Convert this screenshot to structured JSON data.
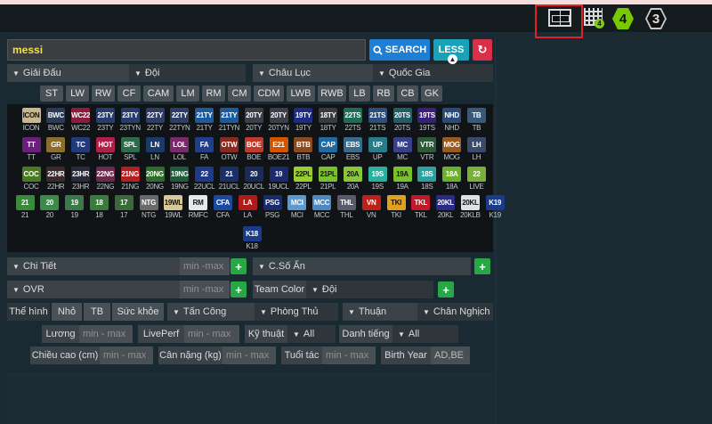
{
  "search": {
    "value": "messi",
    "search_label": "SEARCH",
    "less_label": "LESS",
    "reset_icon": "refresh-icon"
  },
  "filters": {
    "league": "Giải Đấu",
    "team": "Đội",
    "continent": "Châu Lục",
    "nation": "Quốc Gia"
  },
  "positions": [
    "ST",
    "LW",
    "RW",
    "CF",
    "CAM",
    "LM",
    "RM",
    "CM",
    "CDM",
    "LWB",
    "RWB",
    "LB",
    "RB",
    "CB",
    "GK"
  ],
  "seasons": [
    {
      "code": "ICON",
      "badge": "ICON",
      "color": "#c8b889"
    },
    {
      "code": "BWC",
      "badge": "BWC",
      "color": "#2b3a55"
    },
    {
      "code": "WC22",
      "badge": "WC22",
      "color": "#8a1d3d"
    },
    {
      "code": "23TY",
      "badge": "23TY",
      "color": "#273c6e"
    },
    {
      "code": "23TYN",
      "badge": "23TY",
      "color": "#273c6e"
    },
    {
      "code": "22TY",
      "badge": "22TY",
      "color": "#2d3d66"
    },
    {
      "code": "22TYN",
      "badge": "22TY",
      "color": "#2d3d66"
    },
    {
      "code": "21TY",
      "badge": "21TY",
      "color": "#1b5a9c"
    },
    {
      "code": "21TYN",
      "badge": "21TY",
      "color": "#1b5a9c"
    },
    {
      "code": "20TY",
      "badge": "20TY",
      "color": "#3a3f4a"
    },
    {
      "code": "20TYN",
      "badge": "20TY",
      "color": "#3a3f4a"
    },
    {
      "code": "19TY",
      "badge": "19TY",
      "color": "#1c2b86"
    },
    {
      "code": "18TY",
      "badge": "18TY",
      "color": "#3a3a3a"
    },
    {
      "code": "22TS",
      "badge": "22TS",
      "color": "#1e6b56"
    },
    {
      "code": "21TS",
      "badge": "21TS",
      "color": "#2b4f7a"
    },
    {
      "code": "20TS",
      "badge": "20TS",
      "color": "#245c66"
    },
    {
      "code": "19TS",
      "badge": "19TS",
      "color": "#3a1f7a"
    },
    {
      "code": "NHD",
      "badge": "NHD",
      "color": "#2a4a7a"
    },
    {
      "code": "TB",
      "badge": "TB",
      "color": "#385a7a"
    },
    {
      "code": "TT",
      "badge": "TT",
      "color": "#6a1f7a"
    },
    {
      "code": "GR",
      "badge": "GR",
      "color": "#8a6d2f"
    },
    {
      "code": "TC",
      "badge": "TC",
      "color": "#223a7a"
    },
    {
      "code": "HOT",
      "badge": "HOT",
      "color": "#b0204a"
    },
    {
      "code": "SPL",
      "badge": "SPL",
      "color": "#2f6a4a"
    },
    {
      "code": "LN",
      "badge": "LN",
      "color": "#1a3a6a"
    },
    {
      "code": "LOL",
      "badge": "LOL",
      "color": "#7a2a6a"
    },
    {
      "code": "FA",
      "badge": "FA",
      "color": "#1f3f8a"
    },
    {
      "code": "OTW",
      "badge": "OTW",
      "color": "#8a2a1f"
    },
    {
      "code": "BOE",
      "badge": "BOE",
      "color": "#c0392b"
    },
    {
      "code": "BOE21",
      "badge": "E21",
      "color": "#d35400"
    },
    {
      "code": "BTB",
      "badge": "BTB",
      "color": "#8a4a1f"
    },
    {
      "code": "CAP",
      "badge": "CAP",
      "color": "#1f6aa0"
    },
    {
      "code": "EBS",
      "badge": "EBS",
      "color": "#3a6a8a"
    },
    {
      "code": "UP",
      "badge": "UP",
      "color": "#2a7a8a"
    },
    {
      "code": "MC",
      "badge": "MC",
      "color": "#3a3f8a"
    },
    {
      "code": "VTR",
      "badge": "VTR",
      "color": "#2f5a3a"
    },
    {
      "code": "MOG",
      "badge": "MOG",
      "color": "#9a5a1f"
    },
    {
      "code": "LH",
      "badge": "LH",
      "color": "#3a4a6a"
    },
    {
      "code": "COC",
      "badge": "COC",
      "color": "#4a7a1f"
    },
    {
      "code": "22HR",
      "badge": "22HR",
      "color": "#3a2a2a"
    },
    {
      "code": "23HR",
      "badge": "23HR",
      "color": "#2a2a3a"
    },
    {
      "code": "22NG",
      "badge": "22NG",
      "color": "#6a2a4a"
    },
    {
      "code": "21NG",
      "badge": "21NG",
      "color": "#b02020"
    },
    {
      "code": "20NG",
      "badge": "20NG",
      "color": "#2f6a2f"
    },
    {
      "code": "19NG",
      "badge": "19NG",
      "color": "#1f5a3a"
    },
    {
      "code": "22UCL",
      "badge": "22",
      "color": "#1f3a8a"
    },
    {
      "code": "21UCL",
      "badge": "21",
      "color": "#1a2f6a"
    },
    {
      "code": "20UCL",
      "badge": "20",
      "color": "#1a2a5a"
    },
    {
      "code": "19UCL",
      "badge": "19",
      "color": "#1a2a6a"
    },
    {
      "code": "22PL",
      "badge": "22PL",
      "color": "#9acd32"
    },
    {
      "code": "21PL",
      "badge": "21PL",
      "color": "#7ac02a"
    },
    {
      "code": "20A",
      "badge": "20A",
      "color": "#8ac63a"
    },
    {
      "code": "19S",
      "badge": "19S",
      "color": "#2ab0a0"
    },
    {
      "code": "19A",
      "badge": "19A",
      "color": "#7ac02a"
    },
    {
      "code": "18S",
      "badge": "18S",
      "color": "#2aa0a0"
    },
    {
      "code": "18A",
      "badge": "18A",
      "color": "#6ab02a"
    },
    {
      "code": "LIVE",
      "badge": "22",
      "color": "#7ab03a"
    },
    {
      "code": "21",
      "badge": "21",
      "color": "#3a8a3a"
    },
    {
      "code": "20",
      "badge": "20",
      "color": "#3a8a4a"
    },
    {
      "code": "19",
      "badge": "19",
      "color": "#3a7a4a"
    },
    {
      "code": "18",
      "badge": "18",
      "color": "#3a7a3a"
    },
    {
      "code": "17",
      "badge": "17",
      "color": "#3a6a3a"
    },
    {
      "code": "NTG",
      "badge": "NTG",
      "color": "#6a6a6a"
    },
    {
      "code": "19WL",
      "badge": "19WL",
      "color": "#d8c89a"
    },
    {
      "code": "RMFC",
      "badge": "RM",
      "color": "#e8e8e8"
    },
    {
      "code": "CFA",
      "badge": "CFA",
      "color": "#1a4aa0"
    },
    {
      "code": "LA",
      "badge": "LA",
      "color": "#b01a1a"
    },
    {
      "code": "PSG",
      "badge": "PSG",
      "color": "#1a2a6a"
    },
    {
      "code": "MCI",
      "badge": "MCI",
      "color": "#5a9ad0"
    },
    {
      "code": "MCC",
      "badge": "MCC",
      "color": "#4a8ac0"
    },
    {
      "code": "THL",
      "badge": "THL",
      "color": "#5a5a6a"
    },
    {
      "code": "VN",
      "badge": "VN",
      "color": "#c0201a"
    },
    {
      "code": "TKI",
      "badge": "TKI",
      "color": "#e0a020"
    },
    {
      "code": "TKL",
      "badge": "TKL",
      "color": "#c01a2a"
    },
    {
      "code": "20KL",
      "badge": "20KL",
      "color": "#2a2a8a"
    },
    {
      "code": "20KLB",
      "badge": "20KL",
      "color": "#e0e0e0"
    },
    {
      "code": "K19",
      "badge": "K19",
      "color": "#1a3a8a"
    },
    {
      "code": "K18",
      "badge": "K18",
      "color": "#1a3a8a"
    }
  ],
  "stats": {
    "detail": "Chi Tiết",
    "detail_ph": "min -max",
    "hidden": "C.Số Ẩn",
    "ovr": "OVR",
    "ovr_ph": "min -max",
    "team_color": "Team Color",
    "team_color_dd": "Đội",
    "physique": "Thể hình",
    "size_small": "Nhỏ",
    "size_avg": "TB",
    "size_strong": "Sức khỏe",
    "attack": "Tấn Công",
    "defense": "Phòng Thủ",
    "foot": "Thuận",
    "weak_foot": "Chân Nghịch",
    "salary": "Lương",
    "salary_ph": "min - max",
    "liveperf": "LivePerf",
    "liveperf_ph": "min - max",
    "skill": "Kỹ thuật",
    "skill_val": "All",
    "reputation": "Danh tiếng",
    "reputation_val": "All",
    "height": "Chiều cao (cm)",
    "height_ph": "min - max",
    "weight": "Cân nặng (kg)",
    "weight_ph": "min - max",
    "age": "Tuổi tác",
    "age_ph": "min - max",
    "birth_year": "Birth Year",
    "birth_year_ph": "AD,BE"
  },
  "topbar": {
    "badge4": "4",
    "badge3": "3",
    "grid_badge": "4"
  },
  "colors": {
    "accent_red": "#e0222a",
    "search_blue": "#1e7fd4",
    "less_teal": "#18a2b8",
    "plus_green": "#28a745"
  }
}
